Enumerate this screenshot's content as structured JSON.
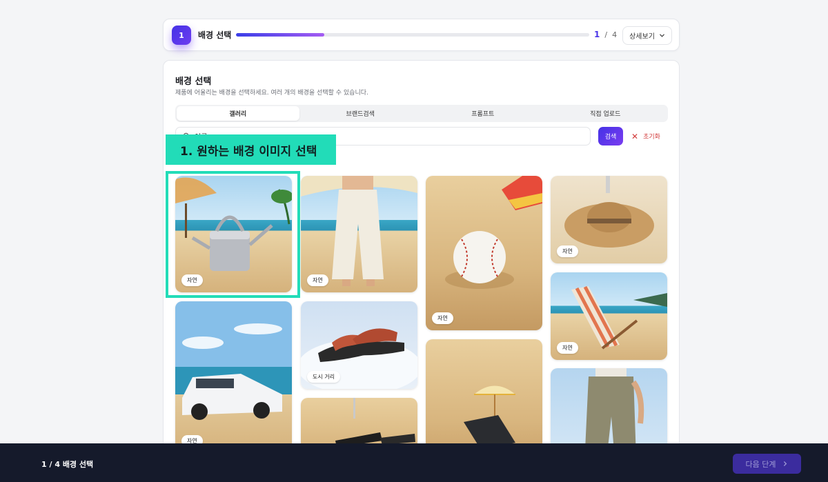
{
  "step": {
    "number": "1",
    "title": "배경 선택",
    "current": "1",
    "separator": "/",
    "total": "4",
    "progress": 0.25,
    "detail_label": "상세보기"
  },
  "section": {
    "title": "배경 선택",
    "description": "제품에 어울리는 배경을 선택하세요. 여러 개의 배경을 선택할 수 있습니다."
  },
  "tabs": [
    {
      "label": "갤러리",
      "active": true
    },
    {
      "label": "브랜드검색",
      "active": false
    },
    {
      "label": "프롬프트",
      "active": false
    },
    {
      "label": "직접 업로드",
      "active": false
    }
  ],
  "search": {
    "value": "여름",
    "button_label": "검색",
    "reset_label": "초기화"
  },
  "gallery": [
    {
      "tag": "자연",
      "subject": "watering can on beach"
    },
    {
      "tag": "자연",
      "subject": "white pants on beach"
    },
    {
      "tag": "자연",
      "subject": "baseball in sand"
    },
    {
      "tag": "자연",
      "subject": "straw hat on sand"
    },
    {
      "tag": "자연",
      "subject": "car on beach"
    },
    {
      "tag": "도시 거리",
      "subject": "sandals in snow"
    },
    {
      "tag": "",
      "subject": "phone with umbrella in sand"
    },
    {
      "tag": "자연",
      "subject": "beach chair"
    },
    {
      "tag": "",
      "subject": "sunglasses in sand"
    },
    {
      "tag": "",
      "subject": "khaki pants"
    }
  ],
  "callout": {
    "text": "1. 원하는 배경 이미지 선택"
  },
  "footer": {
    "status": "1 / 4 배경 선택",
    "next_label": "다음 단계"
  },
  "colors": {
    "accent": "#4a35e8",
    "callout": "#22dcb8",
    "footer_bg": "#151a2b",
    "reset": "#d23b3b"
  }
}
